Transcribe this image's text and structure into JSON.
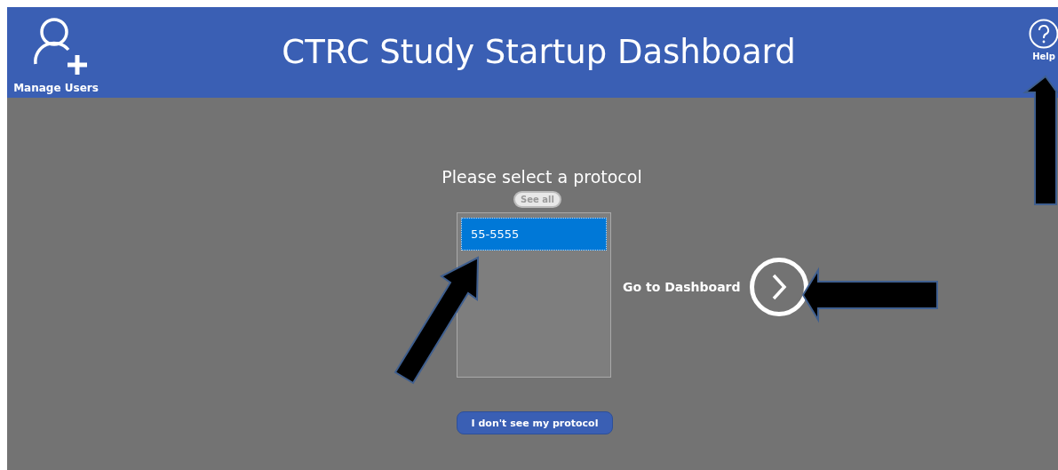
{
  "header": {
    "manage_users": "Manage Users",
    "title": "CTRC Study Startup Dashboard",
    "help": "Help"
  },
  "prompt": "Please select a protocol",
  "see_all_button": "See all",
  "protocols": [
    {
      "label": "55-5555",
      "selected": true
    }
  ],
  "go_to_dashboard": "Go to Dashboard",
  "missing_protocol_button": "I don't see my protocol"
}
